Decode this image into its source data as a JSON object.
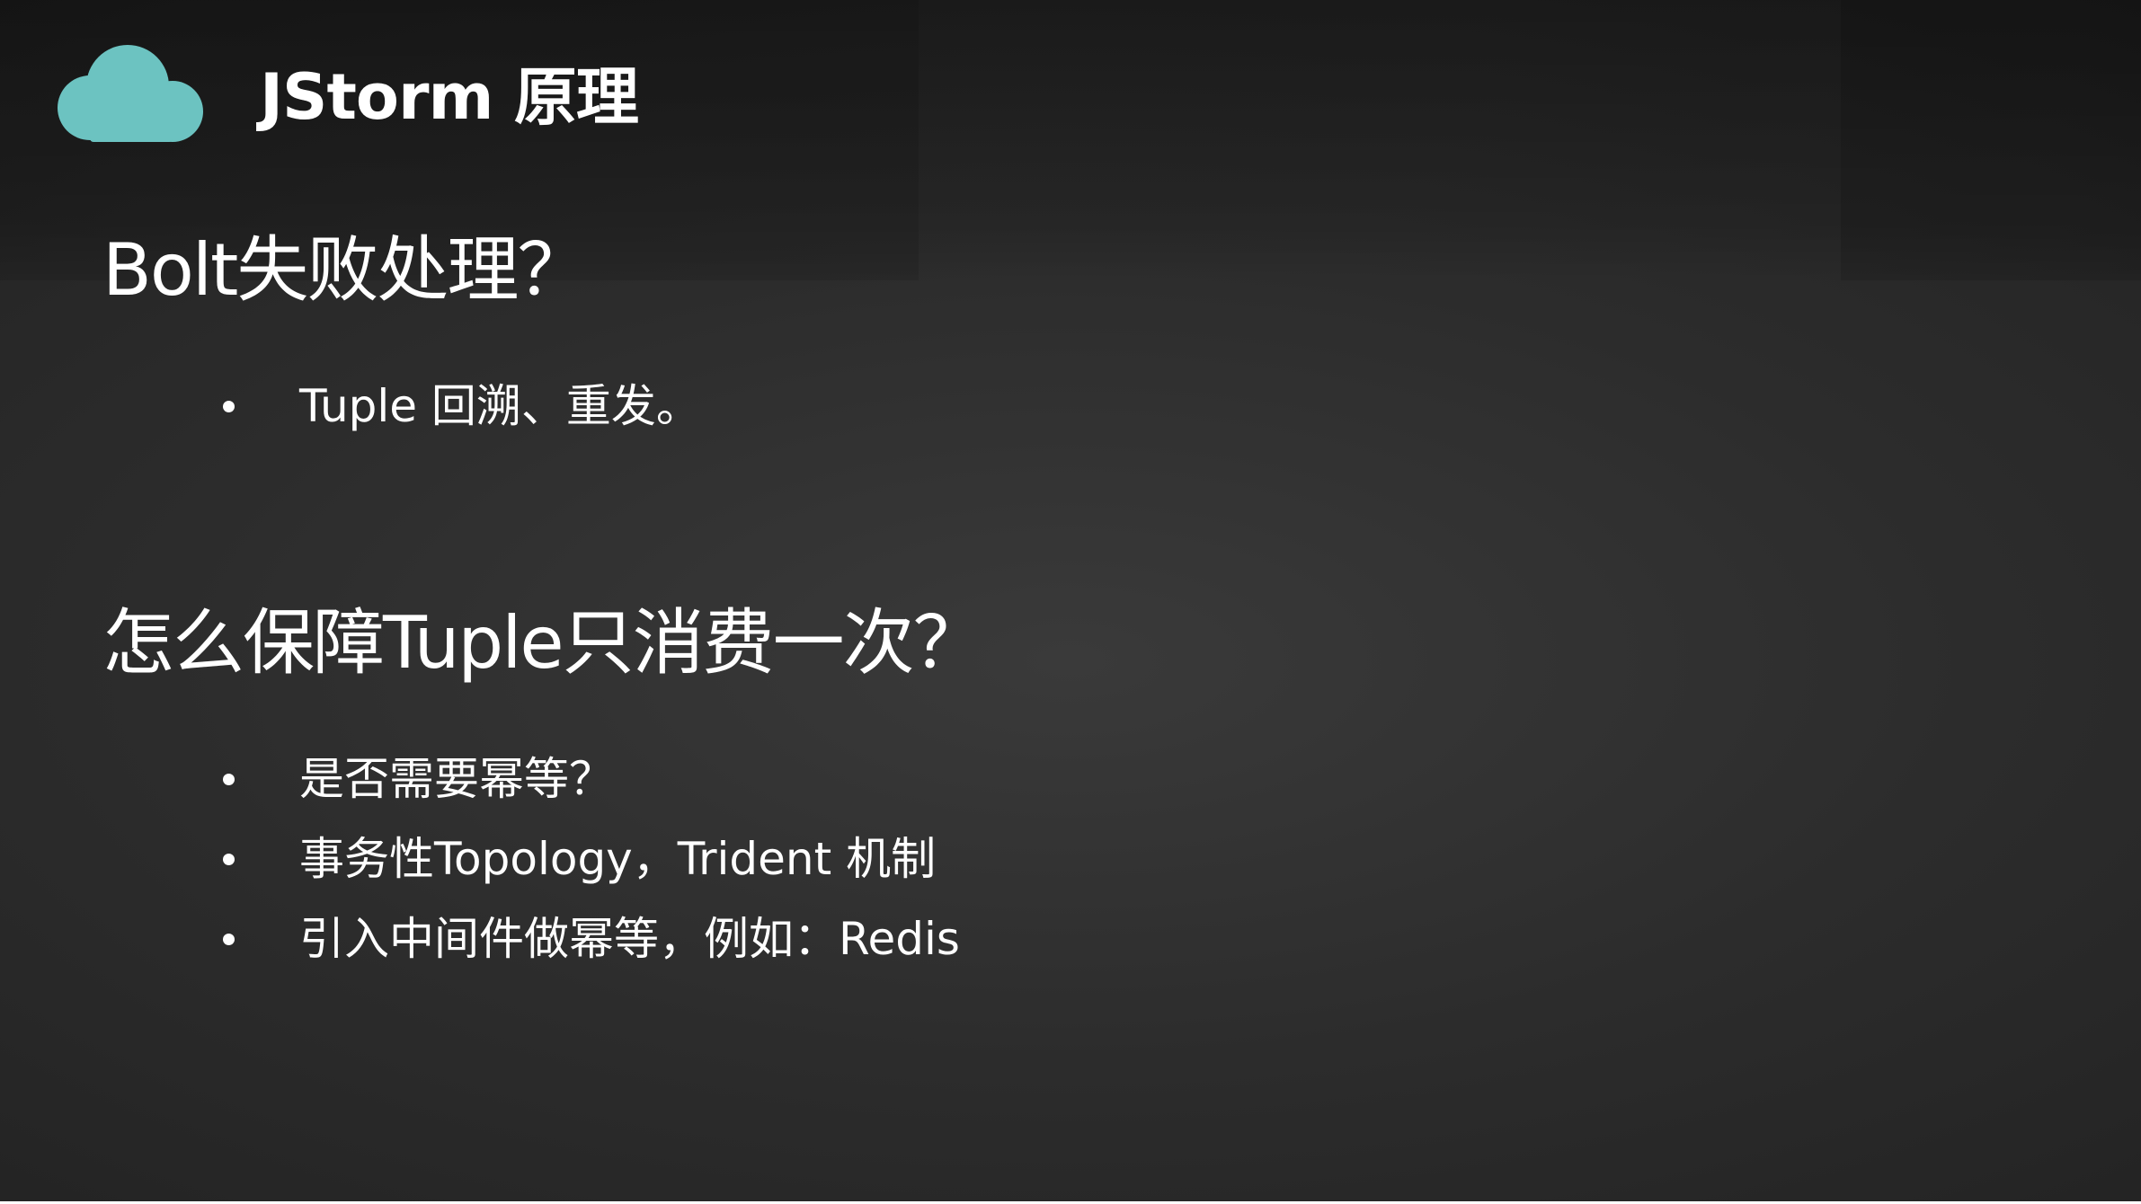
{
  "slide": {
    "title": "JStorm 原理",
    "accent_color": "#6cc3c1",
    "background_color": "#2e2e2e"
  },
  "logo": {
    "icon": "cloud-icon"
  },
  "sections": [
    {
      "heading": "Bolt失败处理？",
      "bullets": [
        "Tuple 回溯、重发。"
      ]
    },
    {
      "heading": "怎么保障Tuple只消费一次？",
      "bullets": [
        "是否需要幂等？",
        "事务性Topology，Trident 机制",
        "引入中间件做幂等，例如：Redis"
      ]
    }
  ]
}
